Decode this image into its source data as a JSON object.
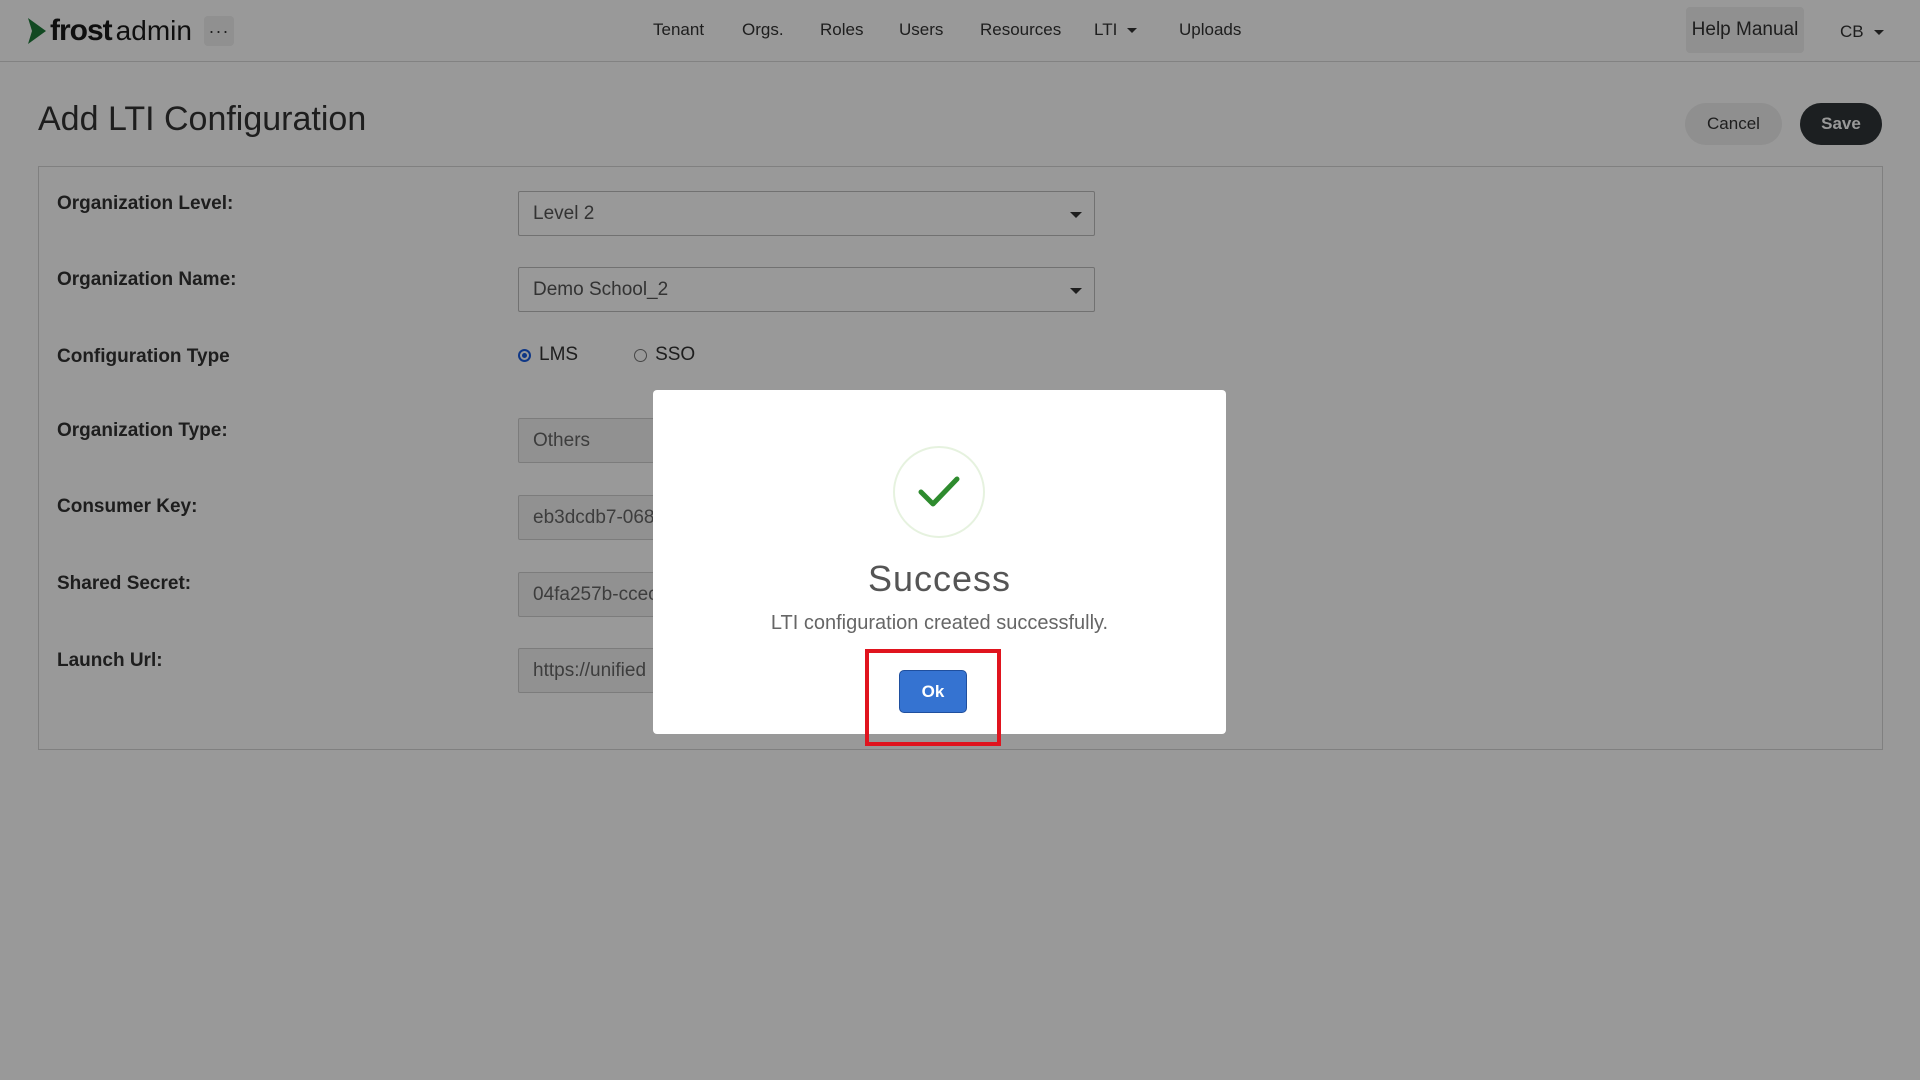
{
  "brand": {
    "word1": "frost",
    "word2": "admin",
    "accent_color": "#1f7a3a"
  },
  "topbar": {
    "more_label": "···",
    "nav": [
      "Tenant",
      "Orgs.",
      "Roles",
      "Users",
      "Resources",
      "LTI",
      "Uploads"
    ],
    "help_label": "Help Manual",
    "user_label": "CB"
  },
  "page": {
    "title": "Add LTI Configuration",
    "cancel_label": "Cancel",
    "save_label": "Save"
  },
  "form": {
    "org_level": {
      "label": "Organization Level:",
      "value": "Level 2"
    },
    "org_name": {
      "label": "Organization Name:",
      "value": "Demo School_2"
    },
    "config_type": {
      "label": "Configuration Type",
      "options": [
        "LMS",
        "SSO"
      ],
      "selected": "LMS"
    },
    "org_type": {
      "label": "Organization Type:",
      "value": "Others"
    },
    "consumer_key": {
      "label": "Consumer Key:",
      "value": "eb3dcdb7-068"
    },
    "shared_secret": {
      "label": "Shared Secret:",
      "value": "04fa257b-ccec"
    },
    "launch_url": {
      "label": "Launch Url:",
      "value": "https://unified"
    }
  },
  "modal": {
    "title": "Success",
    "message": "LTI configuration created successfully.",
    "ok_label": "Ok",
    "check_color": "#2e8b2e",
    "highlight_color": "#e0141e"
  }
}
